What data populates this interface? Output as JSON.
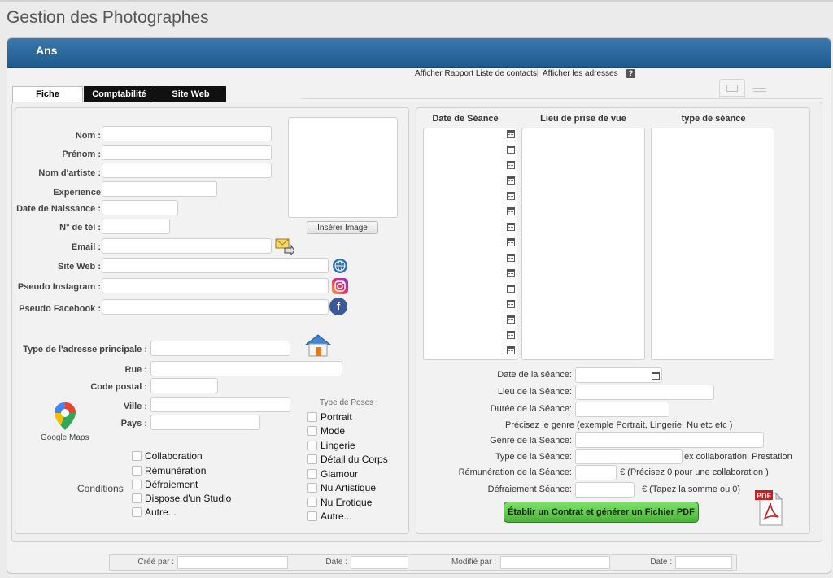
{
  "app": {
    "title": "Gestion des Photographes",
    "section_title": "Ans"
  },
  "toolbar": {
    "report_link": "Afficher Rapport Liste de contacts",
    "separator": "|",
    "addresses_link": "Afficher les adresses",
    "help_label": "?"
  },
  "tabs": [
    {
      "label": "Fiche",
      "active": true
    },
    {
      "label": "Comptabilité",
      "active": false
    },
    {
      "label": "Site Web",
      "active": false
    }
  ],
  "contact": {
    "nom_label": "Nom :",
    "prenom_label": "Prénom :",
    "artiste_label": "Nom d'artiste :",
    "experience_label": "Experience",
    "naissance_label": "Date de Naissance :",
    "tel_label": "N° de tél :",
    "email_label": "Email :",
    "site_label": "Site Web :",
    "instagram_label": "Pseudo Instagram :",
    "facebook_label": "Pseudo Facebook :",
    "insert_image_button": "Insérer Image"
  },
  "address": {
    "type_label": "Type de l'adresse principale :",
    "rue_label": "Rue :",
    "cp_label": "Code postal :",
    "ville_label": "Ville :",
    "pays_label": "Pays :",
    "maps_label": "Google Maps"
  },
  "conditions": {
    "title": "Conditions",
    "items": [
      "Collaboration",
      "Rémunération",
      "Défraiement",
      "Dispose d'un Studio",
      "Autre..."
    ]
  },
  "poses": {
    "title": "Type de Poses :",
    "items": [
      "Portrait",
      "Mode",
      "Lingerie",
      "Détail du Corps",
      "Glamour",
      "Nu Artistique",
      "Nu Erotique",
      "Autre..."
    ]
  },
  "sessions": {
    "col_date": "Date de Séance",
    "col_lieu": "Lieu  de prise de vue",
    "col_type": "type  de séance",
    "date_label": "Date de la séance:",
    "lieu_label": "Lieu de la Séance:",
    "duree_label": "Durée de la Séance:",
    "genre_hint": "Précisez le genre (exemple Portrait, Lingerie, Nu etc etc )",
    "genre_label": "Genre de la Séance:",
    "type_label": "Type de la Séance:",
    "type_hint": "ex collaboration, Prestation",
    "remun_label": "Rémunération de la Séance:",
    "remun_hint": "€  (Précisez 0 pour une collaboration )",
    "defrai_label": "Défraiement Séance:",
    "defrai_hint": "€  (Tapez la somme ou 0)",
    "contract_button": "Établir un Contrat et générer un Fichier PDF",
    "pdf_label": "PDF"
  },
  "footer": {
    "cree_label": "Créé par :",
    "date1_label": "Date :",
    "modifie_label": "Modifié par :",
    "date2_label": "Date :"
  },
  "icons": {
    "email": "email-send-icon",
    "web": "globe-icon",
    "instagram": "instagram-icon",
    "facebook": "facebook-icon",
    "home": "house-icon",
    "maps": "google-maps-pin-icon",
    "pdf": "pdf-file-icon",
    "calendar": "calendar-icon"
  },
  "colors": {
    "header": "#2a6a9f",
    "green_button": "#5cc24a",
    "facebook": "#3b5998"
  }
}
